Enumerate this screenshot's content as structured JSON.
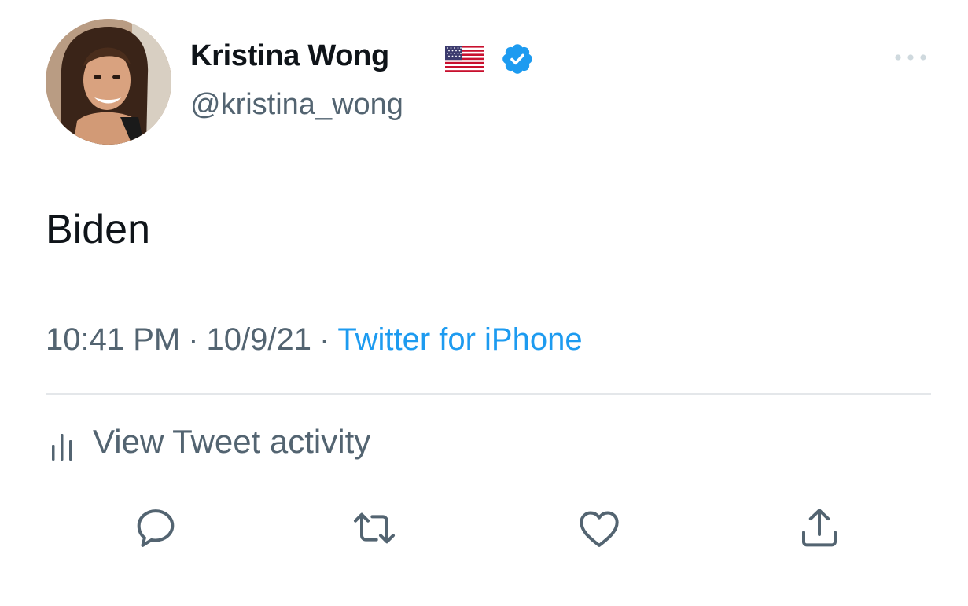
{
  "author": {
    "display_name": "Kristina Wong",
    "handle": "@kristina_wong",
    "flag": "us-flag-emoji",
    "verified": true,
    "avatar": "avatar"
  },
  "tweet": {
    "text": "Biden",
    "time": "10:41 PM",
    "date": "10/9/21",
    "separator": "·",
    "source": "Twitter for iPhone"
  },
  "activity": {
    "label": "View Tweet activity",
    "icon": "bar-chart-icon"
  },
  "actions": [
    {
      "name": "reply",
      "icon": "reply-icon"
    },
    {
      "name": "retweet",
      "icon": "retweet-icon"
    },
    {
      "name": "like",
      "icon": "heart-icon"
    },
    {
      "name": "share",
      "icon": "share-icon"
    }
  ],
  "colors": {
    "text_primary": "#0f1419",
    "text_secondary": "#536471",
    "link": "#1d9bf0",
    "verified": "#1d9bf0",
    "divider": "#e4e7ea"
  }
}
